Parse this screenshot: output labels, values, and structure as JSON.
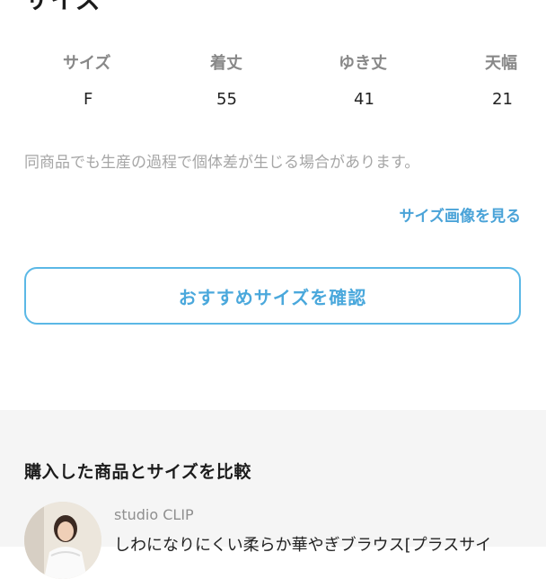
{
  "size_section": {
    "title": "サイズ",
    "headers": [
      "サイズ",
      "着丈",
      "ゆき丈",
      "天幅"
    ],
    "values": [
      "F",
      "55",
      "41",
      "21"
    ],
    "note": "同商品でも生産の過程で個体差が生じる場合があります。",
    "size_image_link": "サイズ画像を見る",
    "recommend_button": "おすすめサイズを確認"
  },
  "compare_section": {
    "title": "購入した商品とサイズを比較",
    "product": {
      "brand": "studio CLIP",
      "name": "しわになりにくい柔らか華やぎブラウス[プラスサイ"
    }
  },
  "colors": {
    "accent": "#4aa8dc",
    "button_border": "#5bb8e6",
    "muted_text": "#a6a6a6",
    "section_bg": "#f5f5f5"
  }
}
